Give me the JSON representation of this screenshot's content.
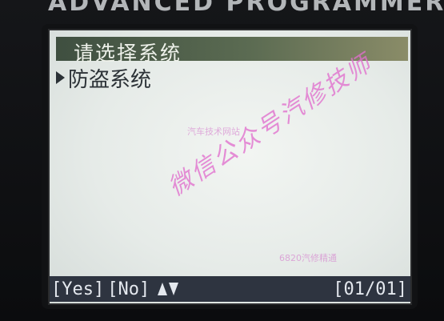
{
  "device": {
    "brand_text": "ADVANCED PROGRAMMER"
  },
  "screen": {
    "header_title": "请选择系统",
    "menu_items": [
      {
        "label": "防盗系统",
        "selected": true
      }
    ],
    "footer": {
      "yes_label": "[Yes]",
      "no_label": "[No]",
      "page_indicator": "[01/01]"
    }
  },
  "overlays": {
    "watermark_main": "微信公众号汽修技师",
    "watermark_small_1": "汽车技术网站",
    "watermark_small_2": "6820汽修精通"
  },
  "colors": {
    "screen_bg": "#e9eeeb",
    "header_bar": "#4f5f4a",
    "footer_bar": "#2e3440",
    "watermark": "#e06ecd"
  },
  "icons": {
    "menu_pointer": "triangle-right",
    "scroll_arrows": "up-down-arrows"
  }
}
